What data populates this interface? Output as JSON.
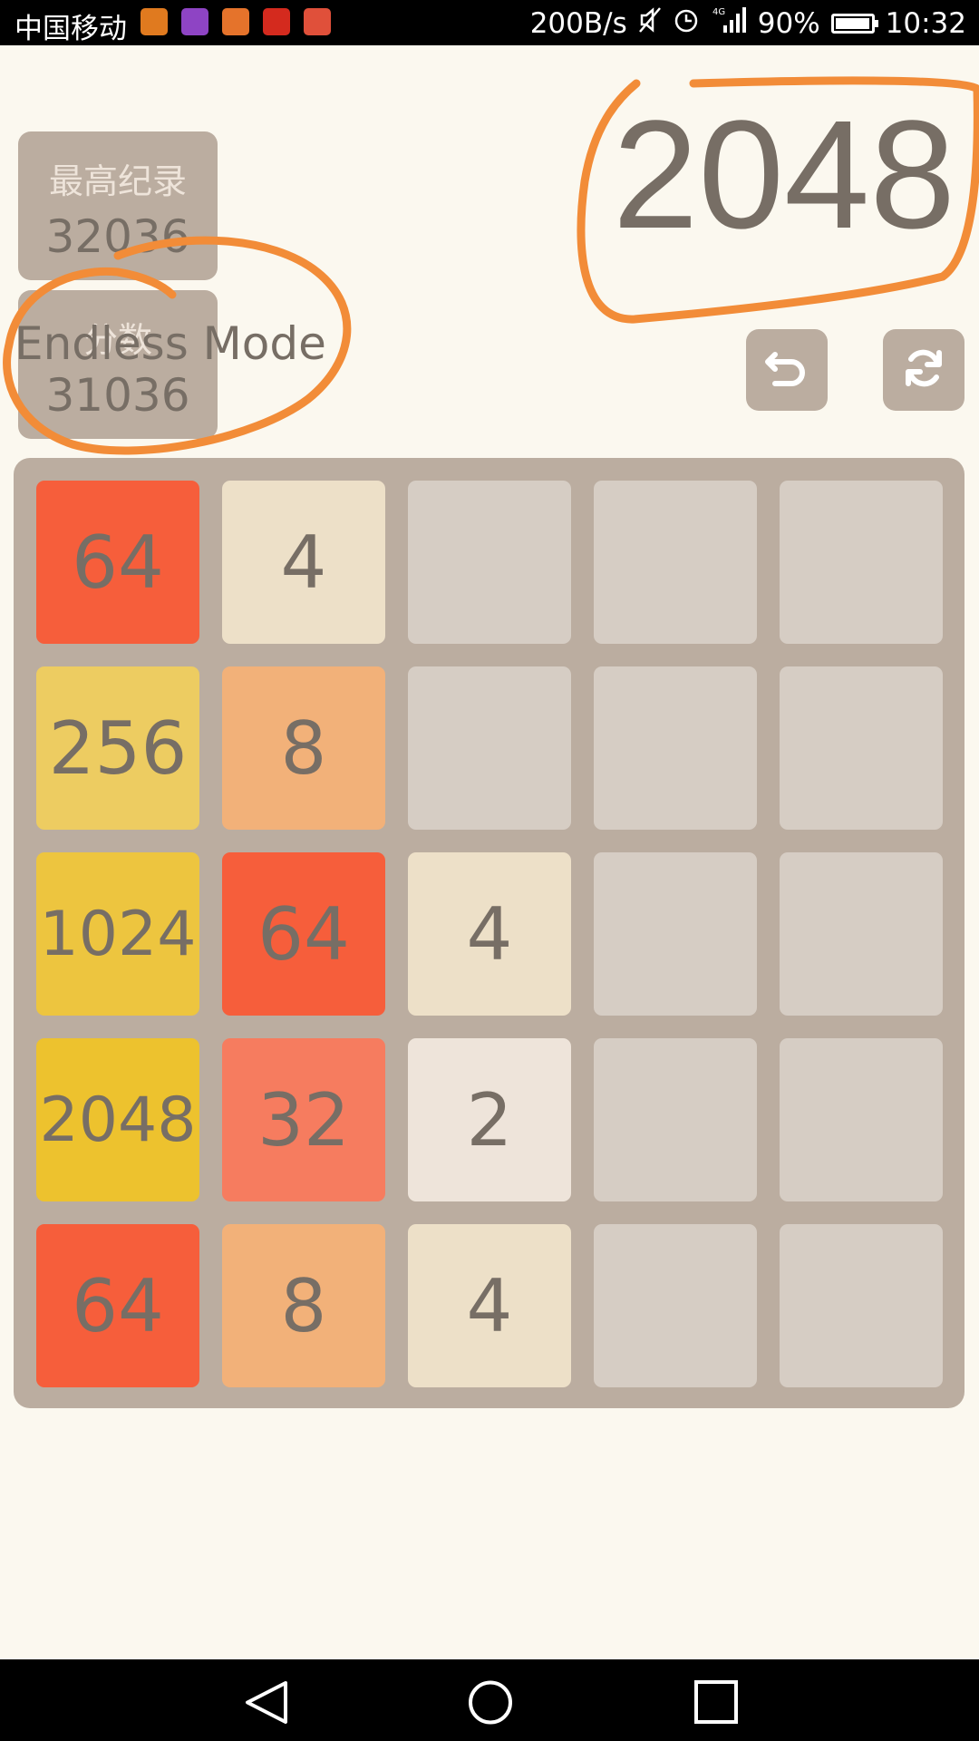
{
  "status_bar": {
    "carrier": "中国移动",
    "net_speed": "200B/s",
    "network": "4G",
    "battery": "90%",
    "time": "10:32",
    "app_icon_colors": [
      "#e07a1f",
      "#8e44c4",
      "#e5732b",
      "#d42a1e",
      "#e0503a"
    ]
  },
  "header": {
    "best_label": "最高纪录",
    "best_value": "32036",
    "score_label": "分数",
    "score_value": "31036",
    "mode_label": "Endless Mode",
    "title": "2048"
  },
  "controls": {
    "undo_icon": "undo-icon",
    "restart_icon": "refresh-icon"
  },
  "board": {
    "size": 5,
    "rows": [
      [
        "64",
        "4",
        "",
        "",
        ""
      ],
      [
        "256",
        "8",
        "",
        "",
        ""
      ],
      [
        "1024",
        "64",
        "4",
        "",
        ""
      ],
      [
        "2048",
        "32",
        "2",
        "",
        ""
      ],
      [
        "64",
        "8",
        "4",
        "",
        ""
      ]
    ]
  },
  "annotation_color": "#f28c38",
  "nav_bar": {
    "back_icon": "back-icon",
    "home_icon": "home-icon",
    "recents_icon": "recents-icon"
  }
}
